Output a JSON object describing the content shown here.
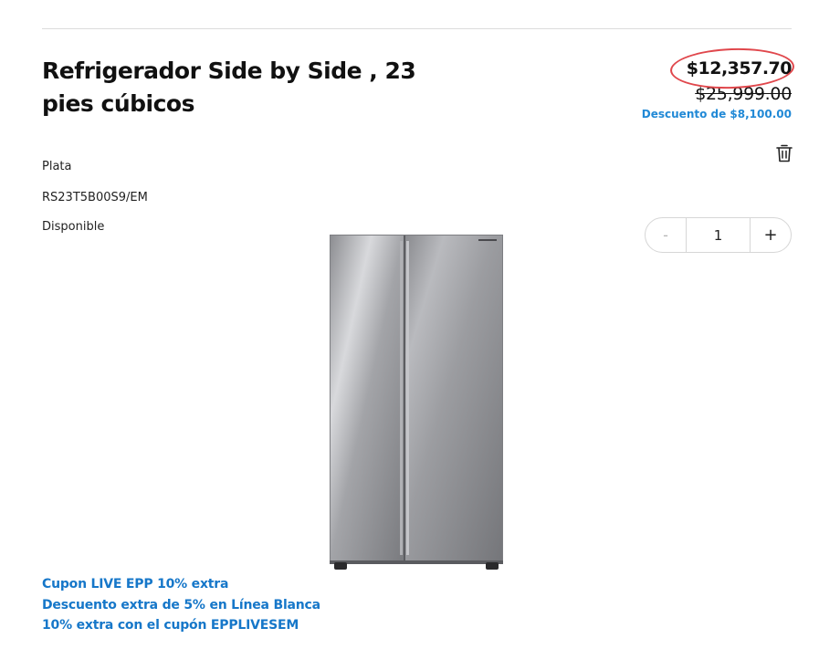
{
  "product": {
    "title": "Refrigerador Side by Side , 23 pies cúbicos",
    "color": "Plata",
    "model": "RS23T5B00S9/EM",
    "availability": "Disponible",
    "image_brand_text": "SAMSUNG"
  },
  "pricing": {
    "current_price": "$12,357.70",
    "original_price": "$25,999.00",
    "discount_text": "Descuento de $8,100.00"
  },
  "quantity": {
    "minus_label": "-",
    "value": "1",
    "plus_label": "+"
  },
  "promotions": [
    "Cupon LIVE EPP 10% extra",
    "Descuento extra de 5% en Línea Blanca",
    "10% extra con el cupón EPPLIVESEM"
  ],
  "icons": {
    "delete": "trash-icon"
  },
  "colors": {
    "link_blue": "#1677c9",
    "discount_blue": "#2189d6",
    "highlight_red": "#e0474c"
  }
}
